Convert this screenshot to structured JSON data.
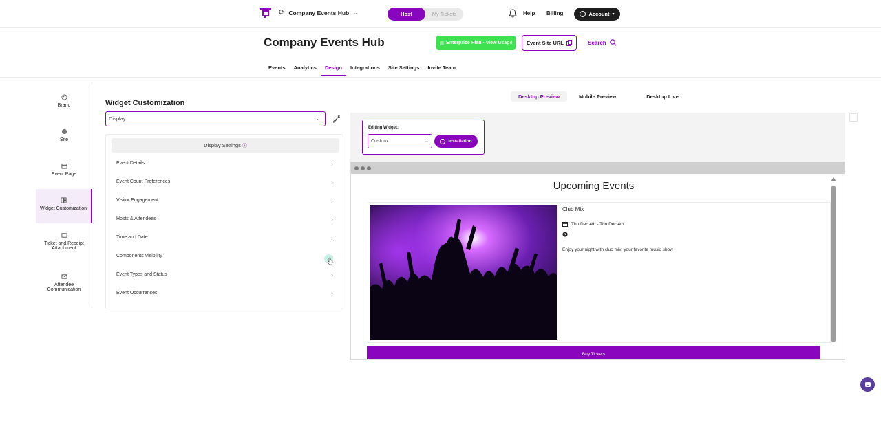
{
  "topbar": {
    "org_name": "Company Events Hub",
    "role_options": [
      "Host",
      "My Tickets"
    ],
    "active_role": "Host",
    "help": "Help",
    "billing": "Billing",
    "account": "Account"
  },
  "header": {
    "title": "Company Events Hub",
    "plan_button": "Enterprise Plan - View Usage",
    "site_url_button": "Event Site URL",
    "search": "Search"
  },
  "nav": {
    "tabs": [
      "Events",
      "Analytics",
      "Design",
      "Integrations",
      "Site Settings",
      "Invite Team"
    ],
    "active": "Design"
  },
  "sidebar": {
    "items": [
      "Brand",
      "Site",
      "Event Page",
      "Widget Customization",
      "Ticket and Receipt Attachment",
      "Attendee Communication"
    ],
    "active": "Widget Customization"
  },
  "panel": {
    "title": "Widget Customization",
    "select_value": "Display",
    "settings_header": "Display Settings",
    "settings": [
      "Event Details",
      "Event Count Preferences",
      "Visitor Engagement",
      "Hosts & Attendees",
      "Time and Date",
      "Components Visibility",
      "Event Types and Status",
      "Event Occurrences"
    ]
  },
  "preview": {
    "tabs": [
      "Desktop Preview",
      "Mobile Preview",
      "Desktop Live"
    ],
    "active_tab": "Desktop Preview",
    "editing_label": "Editing Widget:",
    "widget_select": "Custom",
    "install_button": "Installation",
    "upcoming_title": "Upcoming Events",
    "event": {
      "name": "Club Mix",
      "date": "Thu Dec 4th - Thu Dec 4th",
      "description": "Enjoy your night with club mix, your favorite music show",
      "buy_button": "Buy Tickets"
    }
  },
  "colors": {
    "accent": "#8a05be",
    "plan_green": "#3ee14f"
  }
}
